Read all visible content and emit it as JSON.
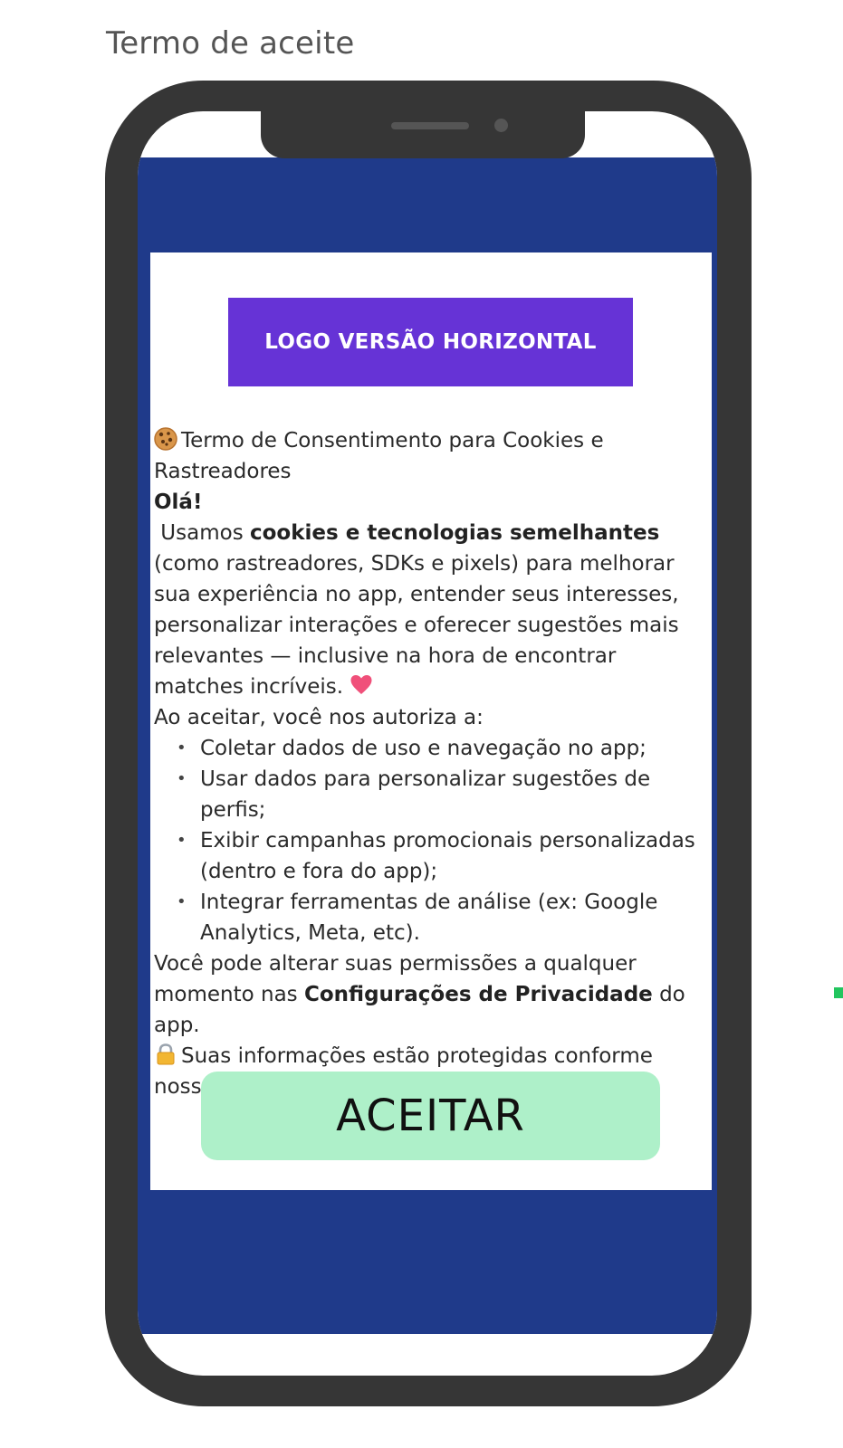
{
  "page": {
    "title": "Termo de aceite"
  },
  "card": {
    "logo_label": "LOGO VERSÃO HORIZONTAL",
    "heading": "Termo de Consentimento para Cookies e Rastreadores",
    "greeting": "Olá!",
    "intro_prefix": " Usamos ",
    "intro_bold": "cookies e tecnologias semelhantes",
    "intro_suffix": " (como rastreadores, SDKs e pixels) para melhorar sua experiência no app, entender seus interesses, personalizar interações e oferecer sugestões mais relevantes — inclusive na hora de encontrar matches incríveis.",
    "authorize_text": "Ao aceitar, você nos autoriza a:",
    "bullets": [
      "Coletar dados de uso e navegação no app;",
      "Usar dados para personalizar sugestões de perfis;",
      "Exibir campanhas promocionais personalizadas (dentro e fora do app);",
      "Integrar ferramentas de análise (ex: Google Analytics, Meta, etc)."
    ],
    "settings_prefix": "Você pode alterar suas permissões a qualquer momento nas ",
    "settings_bold": "Configurações de Privacidade",
    "settings_suffix": " do app.",
    "privacy_text": "Suas informações estão protegidas conforme nossa [Política de Privacidade].",
    "accept_label": "ACEITAR"
  },
  "icons": {
    "heading_icon": "cookie-icon",
    "heart_icon": "heart-icon",
    "lock_icon": "lock-icon"
  },
  "colors": {
    "phone_frame": "#363636",
    "screen_background": "#1f3a8a",
    "logo_background": "#6633d6",
    "accept_button": "#aef0c9"
  }
}
